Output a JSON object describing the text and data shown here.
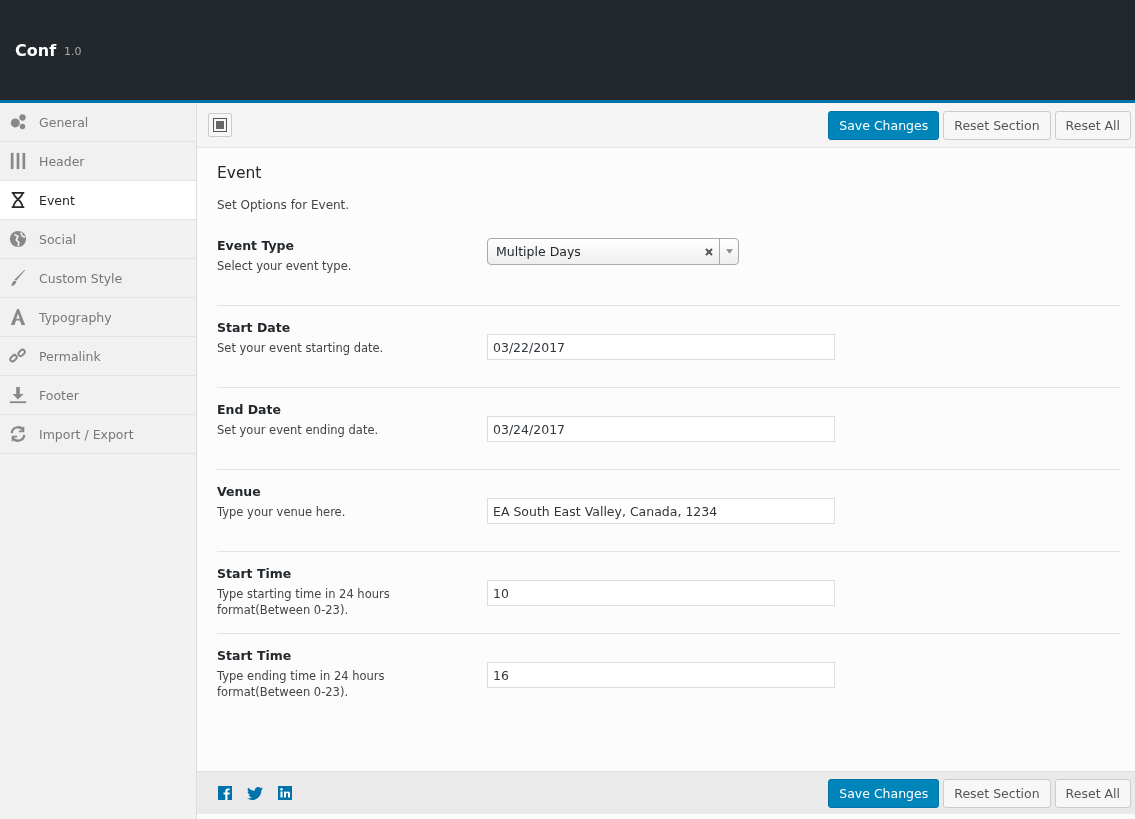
{
  "app": {
    "title": "Conf",
    "version": "1.0"
  },
  "sidebar": {
    "items": [
      {
        "label": "General",
        "selected": false
      },
      {
        "label": "Header",
        "selected": false
      },
      {
        "label": "Event",
        "selected": true
      },
      {
        "label": "Social",
        "selected": false
      },
      {
        "label": "Custom Style",
        "selected": false
      },
      {
        "label": "Typography",
        "selected": false
      },
      {
        "label": "Permalink",
        "selected": false
      },
      {
        "label": "Footer",
        "selected": false
      },
      {
        "label": "Import / Export",
        "selected": false
      }
    ]
  },
  "toolbar": {
    "buttons": [
      {
        "label": "Save Changes",
        "kind": "primary"
      },
      {
        "label": "Reset Section",
        "kind": "secondary"
      },
      {
        "label": "Reset All",
        "kind": "secondary"
      }
    ]
  },
  "section": {
    "title": "Event",
    "description": "Set Options for Event."
  },
  "fields": [
    {
      "kind": "select",
      "label": "Event Type",
      "help": "Select your event type.",
      "value": "Multiple Days"
    },
    {
      "kind": "text",
      "label": "Start Date",
      "help": "Set your event starting date.",
      "value": "03/22/2017"
    },
    {
      "kind": "text",
      "label": "End Date",
      "help": "Set your event ending date.",
      "value": "03/24/2017"
    },
    {
      "kind": "text",
      "label": "Venue",
      "help": "Type your venue here.",
      "value": "EA South East Valley, Canada, 1234"
    },
    {
      "kind": "text",
      "label": "Start Time",
      "help": "Type starting time in 24 hours format(Between 0-23).",
      "value": "10"
    },
    {
      "kind": "text",
      "label": "Start Time",
      "help": "Type ending time in 24 hours format(Between 0-23).",
      "value": "16"
    }
  ],
  "footer": {
    "buttons": [
      {
        "label": "Save Changes",
        "kind": "primary"
      },
      {
        "label": "Reset Section",
        "kind": "secondary"
      },
      {
        "label": "Reset All",
        "kind": "secondary"
      }
    ]
  }
}
